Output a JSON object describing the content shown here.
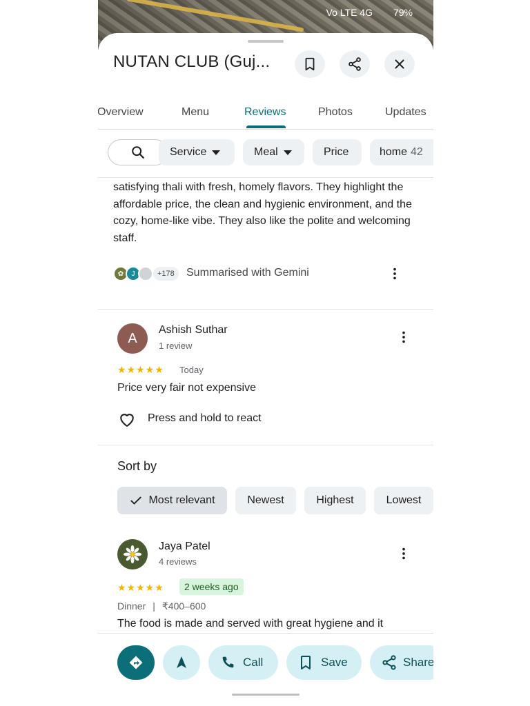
{
  "status_bar": {
    "time": "",
    "network": "Vo LTE 4G",
    "battery": "79%"
  },
  "place": {
    "title": "NUTAN CLUB (Guj..."
  },
  "header_actions": {
    "save_icon": "bookmark-icon",
    "share_icon": "share-icon",
    "close_icon": "close-icon"
  },
  "tabs": [
    {
      "label": "Overview"
    },
    {
      "label": "Menu"
    },
    {
      "label": "Reviews"
    },
    {
      "label": "Photos"
    },
    {
      "label": "Updates"
    }
  ],
  "active_tab": "Reviews",
  "filters": {
    "search_icon": "search-icon",
    "chips": [
      {
        "label": "Service",
        "dropdown": true
      },
      {
        "label": "Meal",
        "dropdown": true
      },
      {
        "label": "Price",
        "dropdown": false
      },
      {
        "label": "home",
        "count": "42"
      }
    ]
  },
  "summary": {
    "text": "satisfying thali with fresh, homely flavors. They highlight the affordable price, the clean and hygienic environment, and the cozy, home-like vibe. They also like the polite and welcoming staff.",
    "avatar_initial": "J",
    "more_count": "+178",
    "label": "Summarised with Gemini"
  },
  "reviews": [
    {
      "name": "Ashish Suthar",
      "initial": "A",
      "avatar_color": "#8d5b52",
      "meta": "1 review",
      "stars": "★★★★★",
      "rating": 5,
      "time": "Today",
      "text": "Price very fair not expensive",
      "react_label": "Press and hold to react"
    },
    {
      "name": "Jaya Patel",
      "meta": "4 reviews",
      "stars": "★★★★★",
      "rating": 5,
      "time": "2 weeks ago",
      "meal": "Dinner",
      "price": "₹400–600",
      "text": "The food is made and served with great hygiene and it"
    }
  ],
  "sort": {
    "title": "Sort by",
    "options": [
      {
        "label": "Most relevant",
        "selected": true
      },
      {
        "label": "Newest"
      },
      {
        "label": "Highest"
      },
      {
        "label": "Lowest"
      }
    ]
  },
  "bottom_actions": {
    "directions_icon": "directions-icon",
    "start_icon": "navigation-arrow-icon",
    "call": "Call",
    "save": "Save",
    "share": "Share"
  },
  "colors": {
    "accent": "#0b6e78",
    "pill_bg": "#d5f0f5",
    "star": "#f4b400"
  }
}
